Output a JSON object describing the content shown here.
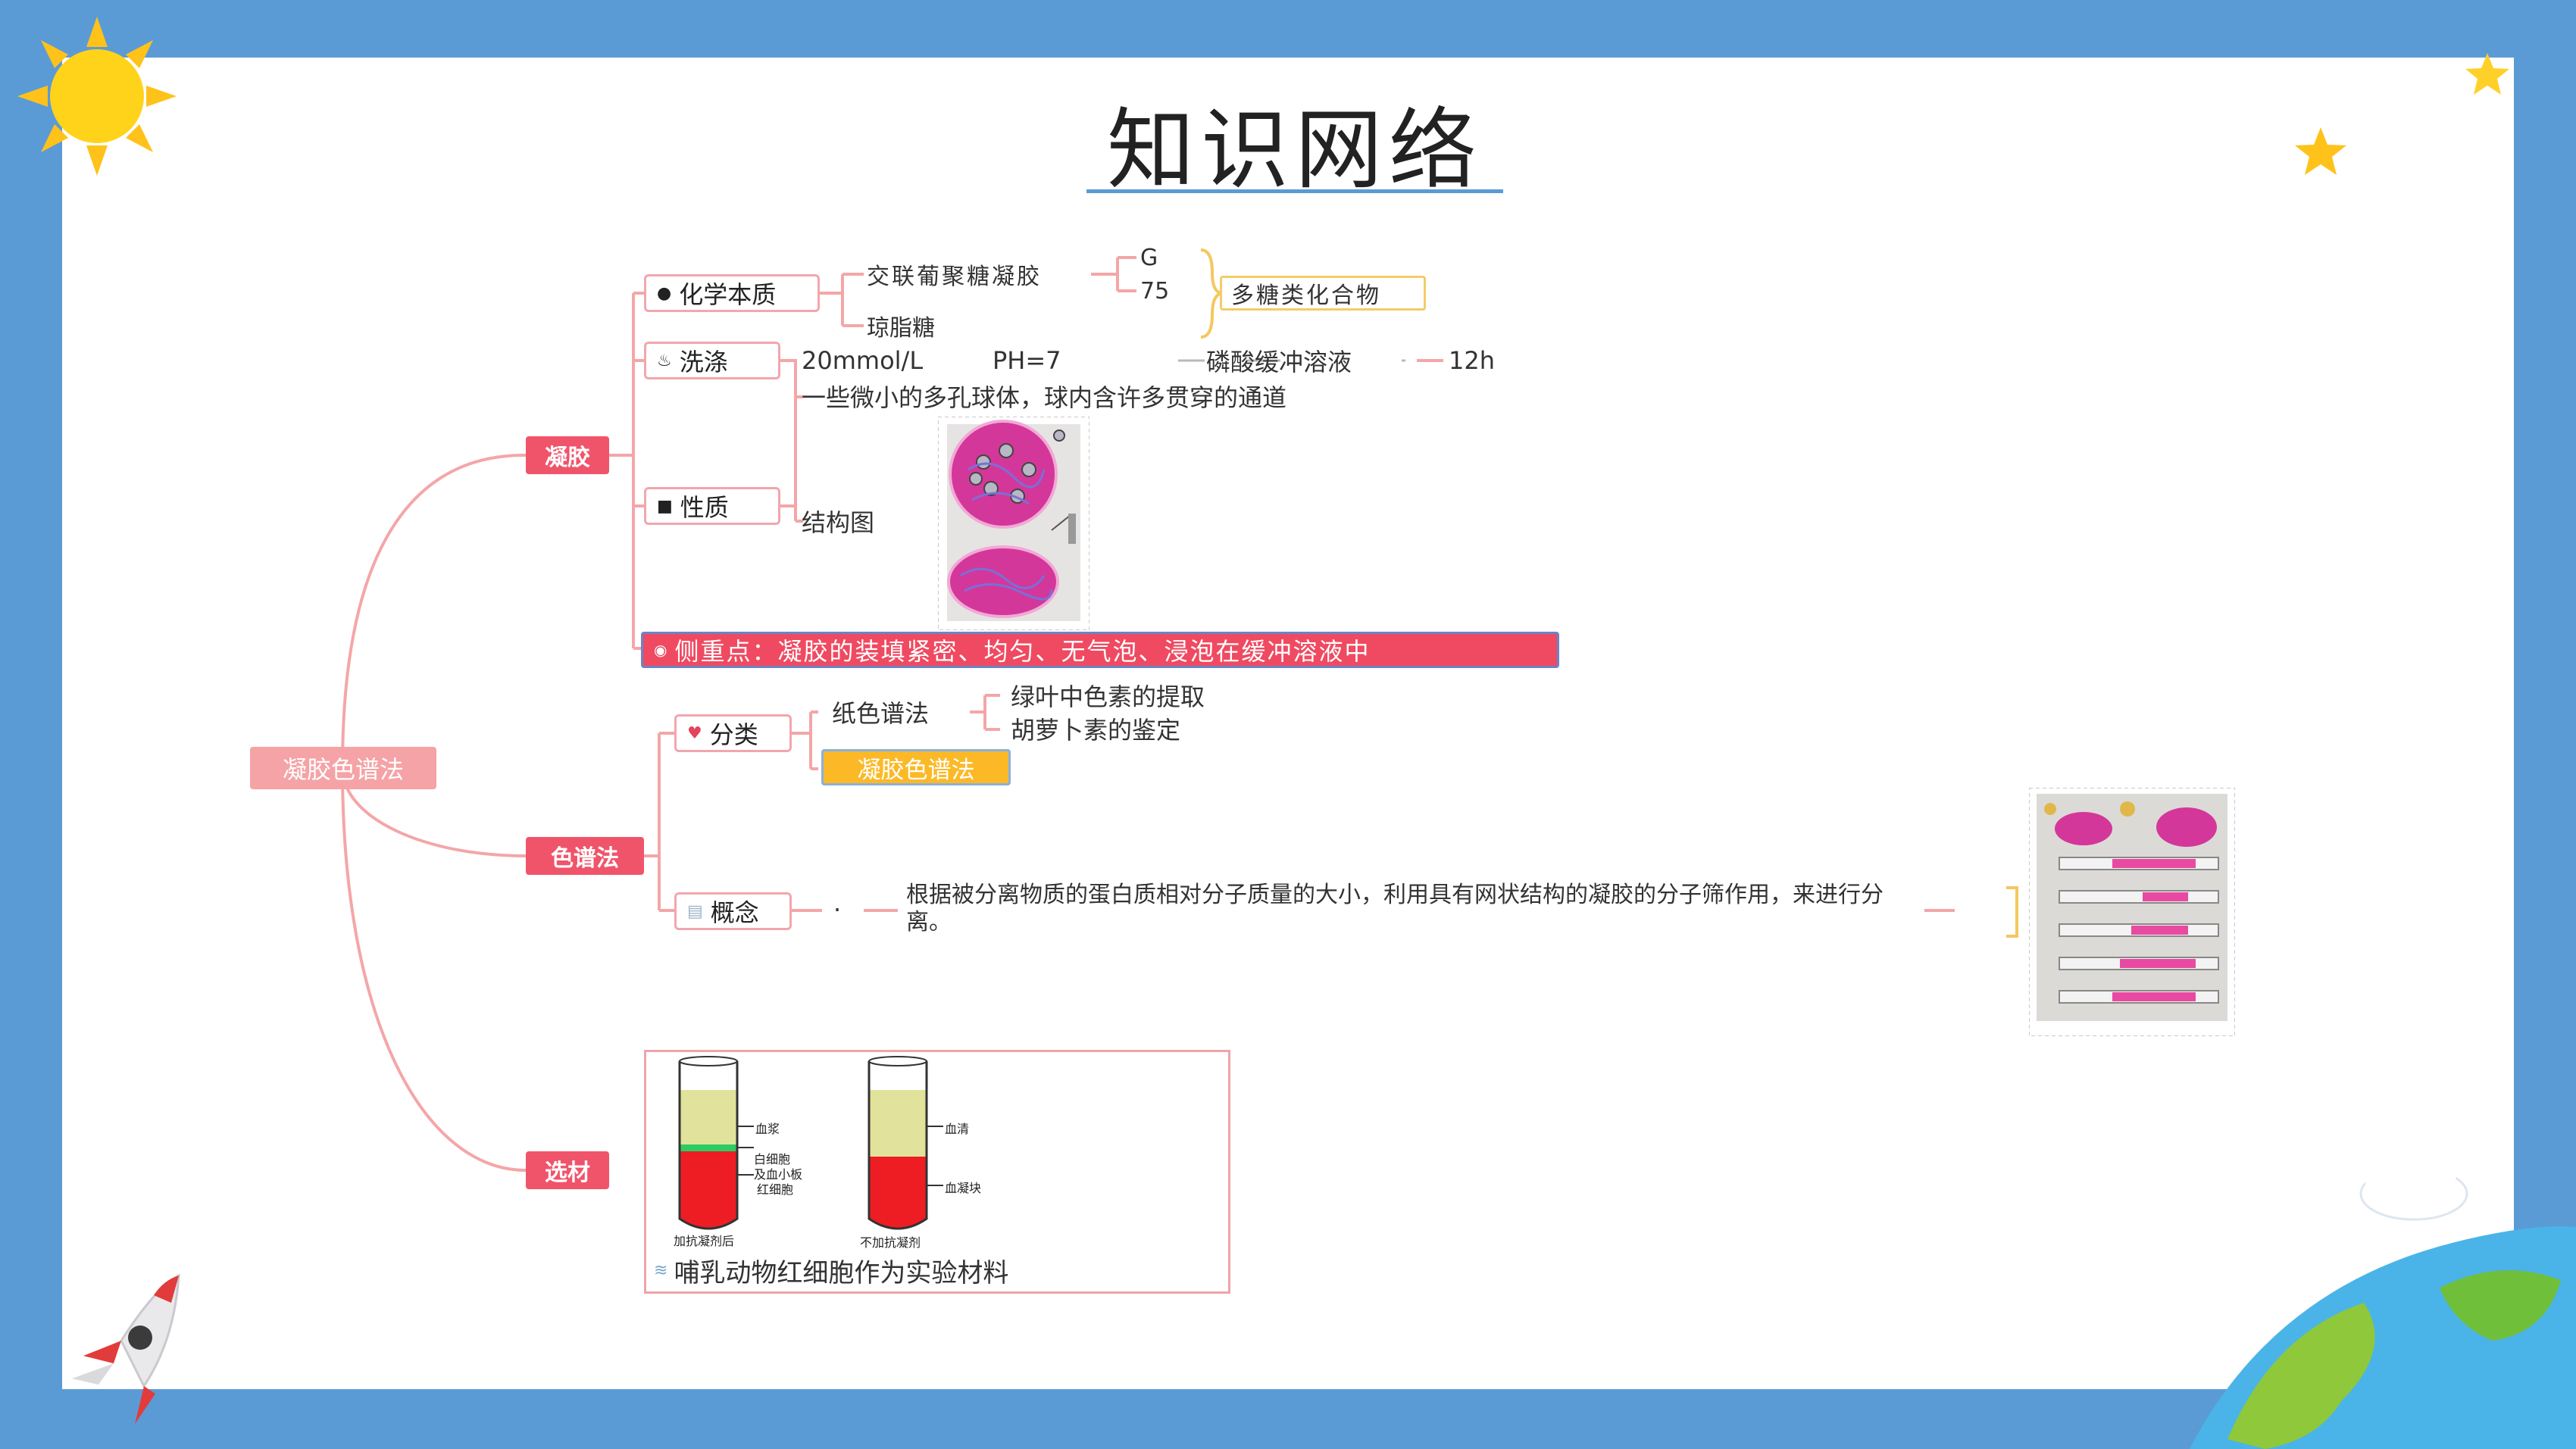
{
  "title": "知识网络",
  "mindmap": {
    "root": "凝胶色谱法",
    "gel": {
      "label": "凝胶",
      "chem": {
        "label": "化学本质",
        "items": [
          "交联葡聚糖凝胶",
          "琼脂糖"
        ],
        "g": "G",
        "g75": "75",
        "polysaccharide": "多糖类化合物"
      },
      "wash": {
        "label": "洗涤",
        "conc": "20mmol/L",
        "ph": "PH=7",
        "buffer": "磷酸缓冲溶液",
        "time": "12h"
      },
      "prop": {
        "label": "性质",
        "desc": "一些微小的多孔球体，球内含许多贯穿的通道",
        "structure": "结构图"
      },
      "focus": "侧重点：凝胶的装填紧密、均匀、无气泡、浸泡在缓冲溶液中"
    },
    "chrom": {
      "label": "色谱法",
      "classify": {
        "label": "分类",
        "paper": "纸色谱法",
        "paper_items": [
          "绿叶中色素的提取",
          "胡萝卜素的鉴定"
        ],
        "gel": "凝胶色谱法"
      },
      "concept": {
        "label": "概念",
        "text": "根据被分离物质的蛋白质相对分子质量的大小，利用具有网状结构的凝胶的分子筛作用，来进行分离。"
      }
    },
    "material": {
      "label": "选材",
      "tube1": {
        "plasma": "血浆",
        "wbc": "白细胞",
        "platelet": "及血小板",
        "rbc": "红细胞",
        "caption": "加抗凝剂后"
      },
      "tube2": {
        "serum": "血清",
        "clot": "血凝块",
        "caption": "不加抗凝剂"
      },
      "caption": "哺乳动物红细胞作为实验材料"
    }
  },
  "colors": {
    "frame": "#5b9bd5",
    "branch": "#f0546a",
    "root": "#f5a3a6",
    "link": "#f4a6a8",
    "highlight_yellow": "#fcb927"
  }
}
